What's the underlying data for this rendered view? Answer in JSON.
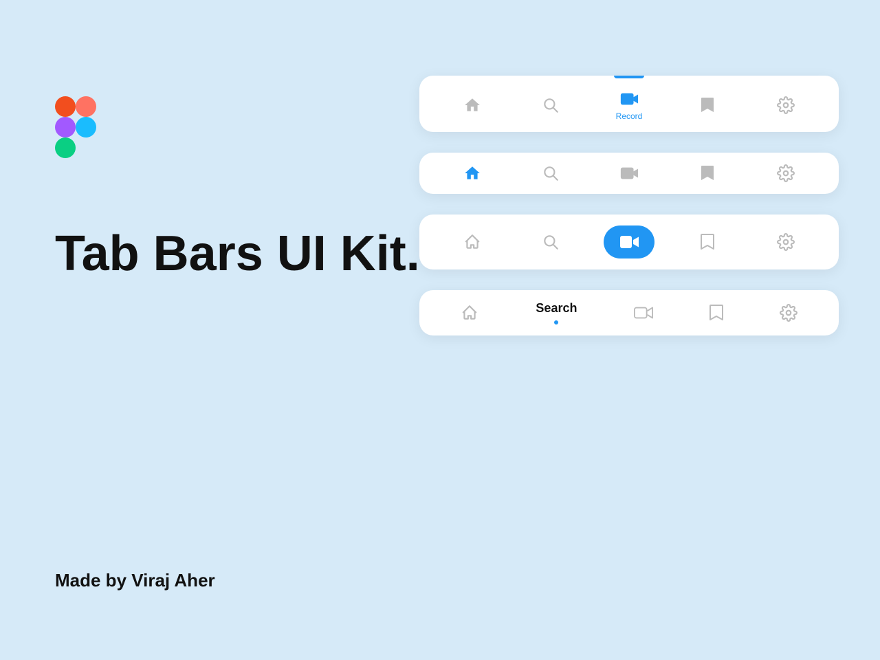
{
  "app": {
    "background": "#d6eaf8",
    "title": "Tab Bars UI Kit.",
    "made_by": "Made by Viraj Aher"
  },
  "figma_logo": {
    "alt": "Figma logo"
  },
  "tab_bars": [
    {
      "id": "bar1",
      "style": "filled-icon-with-label",
      "active_index": 2,
      "active_indicator": "top-line",
      "items": [
        {
          "icon": "home",
          "label": ""
        },
        {
          "icon": "search",
          "label": ""
        },
        {
          "icon": "record",
          "label": "Record"
        },
        {
          "icon": "bookmark",
          "label": ""
        },
        {
          "icon": "settings",
          "label": ""
        }
      ]
    },
    {
      "id": "bar2",
      "style": "filled-icon-no-label",
      "active_index": 0,
      "active_indicator": "none",
      "items": [
        {
          "icon": "home",
          "label": ""
        },
        {
          "icon": "search",
          "label": ""
        },
        {
          "icon": "record",
          "label": ""
        },
        {
          "icon": "bookmark",
          "label": ""
        },
        {
          "icon": "settings",
          "label": ""
        }
      ]
    },
    {
      "id": "bar3",
      "style": "outline-icon-pill",
      "active_index": 2,
      "active_indicator": "pill",
      "items": [
        {
          "icon": "home",
          "label": ""
        },
        {
          "icon": "search",
          "label": ""
        },
        {
          "icon": "record",
          "label": ""
        },
        {
          "icon": "bookmark",
          "label": ""
        },
        {
          "icon": "settings",
          "label": ""
        }
      ]
    },
    {
      "id": "bar4",
      "style": "outline-icon-text-active",
      "active_index": 1,
      "active_indicator": "dot",
      "items": [
        {
          "icon": "home",
          "label": ""
        },
        {
          "icon": "search",
          "label": "Search"
        },
        {
          "icon": "record",
          "label": ""
        },
        {
          "icon": "bookmark",
          "label": ""
        },
        {
          "icon": "settings",
          "label": ""
        }
      ]
    }
  ]
}
